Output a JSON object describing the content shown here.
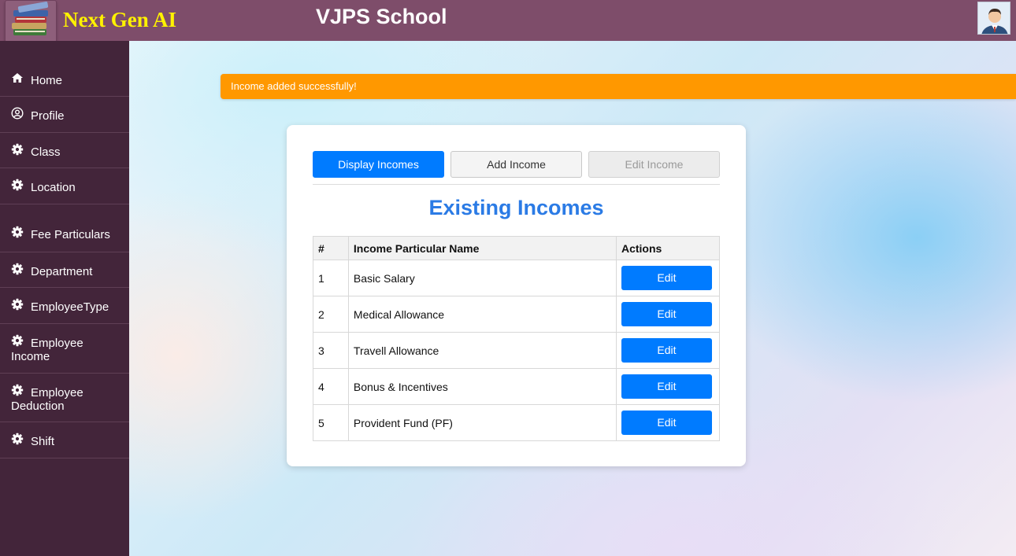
{
  "header": {
    "brand": "Next Gen AI",
    "school_name": "VJPS School",
    "logo_icon": "books-icon",
    "avatar_icon": "user-avatar-icon"
  },
  "sidebar": {
    "items": [
      {
        "label": "Home",
        "icon": "home-icon"
      },
      {
        "label": "Profile",
        "icon": "user-circle-icon"
      },
      {
        "label": "Class",
        "icon": "gear-icon"
      },
      {
        "label": "Location",
        "icon": "gear-icon"
      },
      {
        "label": "Fee Particulars",
        "icon": "gear-icon"
      },
      {
        "label": "Department",
        "icon": "gear-icon"
      },
      {
        "label": "EmployeeType",
        "icon": "gear-icon"
      },
      {
        "label": "Employee",
        "label2": "Income",
        "icon": "gear-icon"
      },
      {
        "label": "Employee",
        "label2": "Deduction",
        "icon": "gear-icon"
      },
      {
        "label": "Shift",
        "icon": "gear-icon"
      }
    ]
  },
  "alert": {
    "message": "Income added successfully!"
  },
  "tabs": {
    "display": "Display Incomes",
    "add": "Add Income",
    "edit": "Edit Income"
  },
  "main": {
    "heading": "Existing Incomes"
  },
  "table": {
    "headers": [
      "#",
      "Income Particular Name",
      "Actions"
    ],
    "rows": [
      {
        "num": "1",
        "name": "Basic Salary",
        "action": "Edit"
      },
      {
        "num": "2",
        "name": "Medical Allowance",
        "action": "Edit"
      },
      {
        "num": "3",
        "name": "Travell Allowance",
        "action": "Edit"
      },
      {
        "num": "4",
        "name": "Bonus & Incentives",
        "action": "Edit"
      },
      {
        "num": "5",
        "name": "Provident Fund (PF)",
        "action": "Edit"
      }
    ]
  },
  "colors": {
    "header_bg": "#7e4d6a",
    "brand_text": "#fff200",
    "sidebar_bg": "#43253a",
    "alert_bg": "#ff9800",
    "primary": "#007bff",
    "heading": "#2b7be5"
  }
}
